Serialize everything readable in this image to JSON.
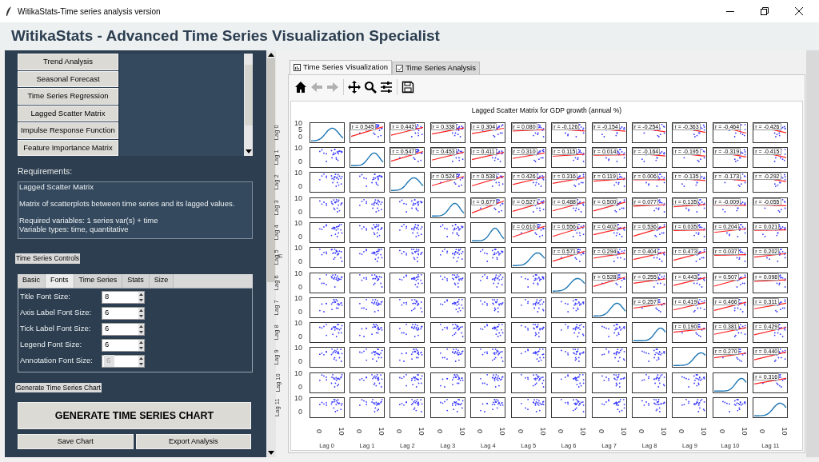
{
  "window": {
    "title": "WitikaStats-Time series analysis version"
  },
  "header": {
    "title": "WitikaStats - Advanced Time Series Visualization Specialist"
  },
  "analysis_list": {
    "items": [
      {
        "label": "Trend Analysis"
      },
      {
        "label": "Seasonal Forecast"
      },
      {
        "label": "Time Series Regression"
      },
      {
        "label": "Lagged Scatter Matrix"
      },
      {
        "label": "Impulse Response Function"
      },
      {
        "label": "Feature Importance Matrix"
      }
    ]
  },
  "requirements": {
    "label": "Requirements:",
    "blocks": [
      [
        "Lagged Scatter Matrix"
      ],
      [
        "Matrix of scatterplots between time series and its lagged values."
      ],
      [
        "Required variables: 1 series var(s) + time",
        "Variable types: time, quantitative"
      ]
    ]
  },
  "controls": {
    "label": "Time Series Controls",
    "tabs": [
      {
        "label": "Basic",
        "selected": false
      },
      {
        "label": "Fonts",
        "selected": true
      },
      {
        "label": "Time Series",
        "selected": false
      },
      {
        "label": "Stats",
        "selected": false
      },
      {
        "label": "Size",
        "selected": false
      }
    ],
    "fields": [
      {
        "label": "Title Font Size:",
        "value": "8",
        "disabled": false
      },
      {
        "label": "Axis Label Font Size:",
        "value": "6",
        "disabled": false
      },
      {
        "label": "Tick Label Font Size:",
        "value": "6",
        "disabled": false
      },
      {
        "label": "Legend Font Size:",
        "value": "6",
        "disabled": false
      },
      {
        "label": "Annotation Font Size:",
        "value": "6",
        "disabled": true
      }
    ]
  },
  "generate": {
    "label": "Generate Time Series Chart",
    "button": "GENERATE TIME SERIES CHART"
  },
  "buttons": [
    "Save Chart",
    "Export Analysis"
  ],
  "viz": {
    "tabs": [
      {
        "label": "Time Series Visualization",
        "selected": true
      },
      {
        "label": "Time Series Analysis",
        "selected": false
      }
    ],
    "matrix": {
      "title": "Lagged Scatter Matrix for GDP growth (annual %)",
      "row_labels": [
        "Lag 0",
        "Lag 1",
        "Lag 2",
        "Lag 3",
        "Lag 4",
        "Lag 5",
        "Lag 6",
        "Lag 7",
        "Lag 8",
        "Lag 9",
        "Lag 10",
        "Lag 11"
      ],
      "column_labels": [
        "Lag 0",
        "Lag 1",
        "Lag 2",
        "Lag 3",
        "Lag 4",
        "Lag 5",
        "Lag 6",
        "Lag 7",
        "Lag 8",
        "Lag 9",
        "Lag 10",
        "Lag 11"
      ],
      "y_ticks": [
        [
          "10",
          "5",
          "0"
        ],
        [
          "10",
          "0"
        ],
        [
          "10",
          "0"
        ],
        [
          "10",
          "0"
        ],
        [
          "10",
          "0"
        ],
        [
          "10",
          "0"
        ],
        [
          "10",
          "0"
        ],
        [
          "10",
          "0"
        ],
        [
          "10",
          "0"
        ],
        [
          "10",
          "0"
        ],
        [
          "10",
          "0"
        ],
        [
          "10",
          "0"
        ]
      ],
      "x_ticks": [
        [
          "0",
          "10"
        ],
        [
          "0",
          "10"
        ],
        [
          "0",
          "10"
        ],
        [
          "0",
          "10"
        ],
        [
          "0",
          "10"
        ],
        [
          "0",
          "10"
        ],
        [
          "0",
          "10"
        ],
        [
          "0",
          "10"
        ],
        [
          "0",
          "10"
        ],
        [
          "0",
          "10"
        ],
        [
          "0",
          "10"
        ],
        [
          "0",
          "10"
        ]
      ],
      "correlations": [
        [
          "r = 0.545",
          "r = 0.442",
          "r = 0.338",
          "r = 0.304",
          "r = 0.080",
          "r = -0.126",
          "r = -0.154",
          "r = -0.254",
          "r = -0.363",
          "r = -0.464",
          "r = -0.426"
        ],
        [
          "r = 0.547",
          "r = 0.453",
          "r = 0.411",
          "r = 0.310",
          "r = 0.115",
          "r = 0.014",
          "r = -0.164",
          "r = -0.195",
          "r = -0.319",
          "r = -0.415"
        ],
        [
          "r = 0.524",
          "r = 0.538",
          "r = 0.426",
          "r = 0.316",
          "r = 0.119",
          "r = 0.006",
          "r = -0.135",
          "r = -0.173",
          "r = -0.292"
        ],
        [
          "r = 0.677",
          "r = 0.527",
          "r = 0.488",
          "r = 0.500",
          "r = 0.077",
          "r = 0.135",
          "r = -0.009",
          "r = -0.055"
        ],
        [
          "r = 0.610",
          "r = 0.556",
          "r = 0.402",
          "r = 0.536",
          "r = 0.035",
          "r = 0.204",
          "r = 0.021"
        ],
        [
          "r = 0.571",
          "r = 0.294",
          "r = 0.404",
          "r = 0.473",
          "r = 0.037",
          "r = 0.202"
        ],
        [
          "r = 0.528",
          "r = 0.255",
          "r = 0.443",
          "r = 0.507",
          "r = 0.098"
        ],
        [
          "r = 0.257",
          "r = 0.419",
          "r = 0.466",
          "r = 0.311"
        ],
        [
          "r = 0.190",
          "r = 0.381",
          "r = 0.429"
        ],
        [
          "r = 0.270",
          "r = 0.440"
        ],
        [
          "r = 0.316"
        ]
      ]
    }
  }
}
